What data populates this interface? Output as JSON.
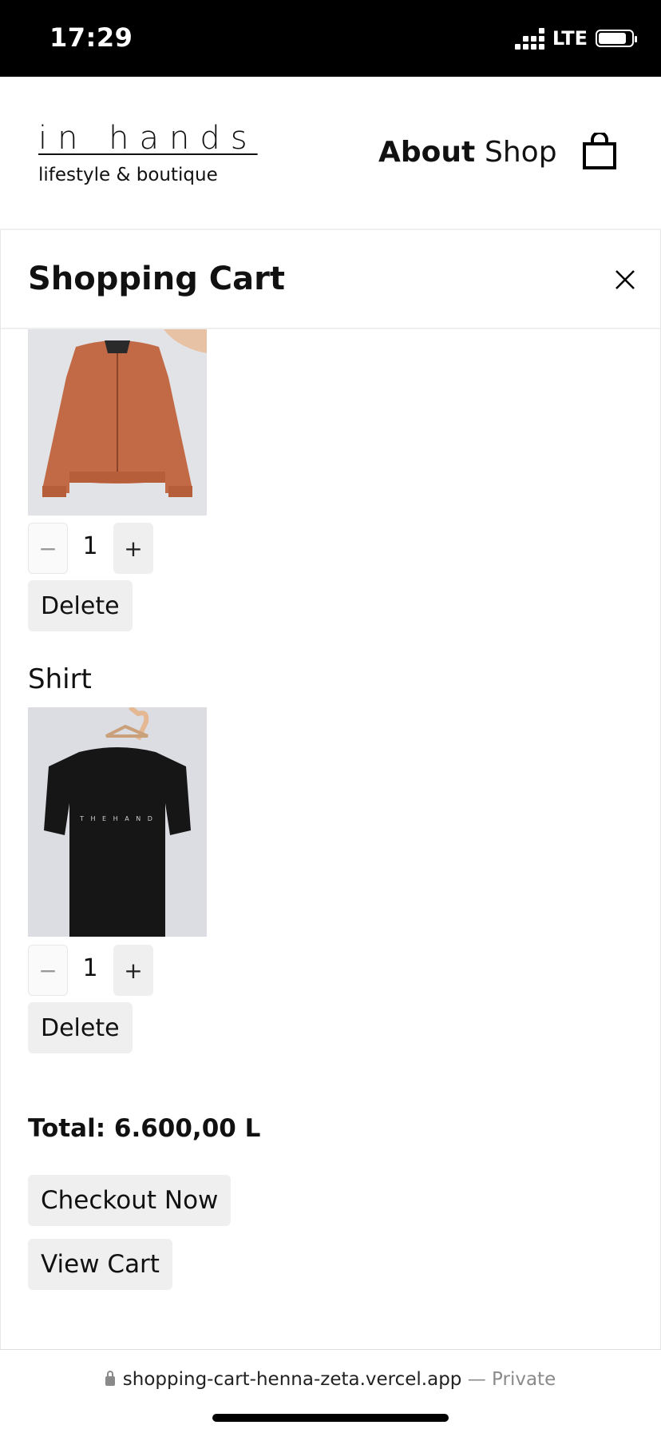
{
  "status_bar": {
    "time": "17:29",
    "network": "LTE",
    "battery_level": 0.85
  },
  "header": {
    "logo_main": "in hands",
    "logo_sub": "lifestyle & boutique",
    "nav": {
      "about": "About",
      "shop": "Shop"
    },
    "cart_icon": "shopping-bag-icon"
  },
  "cart": {
    "title": "Shopping Cart",
    "close_icon": "close-icon",
    "items": [
      {
        "name": "",
        "image": "orange bomber jacket",
        "quantity": "1",
        "minus": "−",
        "plus": "+",
        "delete_label": "Delete"
      },
      {
        "name": "Shirt",
        "image": "black t-shirt",
        "quantity": "1",
        "minus": "−",
        "plus": "+",
        "delete_label": "Delete"
      }
    ],
    "total_label": "Total: 6.600,00 L",
    "checkout_label": "Checkout Now",
    "view_cart_label": "View Cart"
  },
  "browser": {
    "url": "shopping-cart-henna-zeta.vercel.app",
    "mode": "— Private"
  },
  "colors": {
    "accent": "#000000",
    "button_bg": "#efefef",
    "jacket": "#c26a45",
    "shirt": "#161616"
  }
}
